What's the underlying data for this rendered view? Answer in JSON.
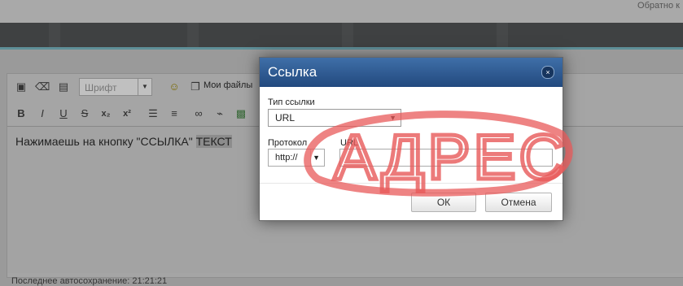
{
  "topbar": {
    "right_link": "Обратно к"
  },
  "toolbar": {
    "font_placeholder": "Шрифт",
    "my_files_label": "Мои файлы",
    "bold": "B",
    "italic": "I",
    "underline": "U",
    "strike": "S",
    "subscript": "x₂",
    "superscript": "x²"
  },
  "editor": {
    "text_before": "Нажимаешь на кнопку \"ССЫЛКА\" ",
    "text_selected": "ТЕКСТ",
    "autosave": "Последнее автосохранение: 21:21:21"
  },
  "dialog": {
    "title": "Ссылка",
    "link_type_label": "Тип ссылки",
    "link_type_value": "URL",
    "protocol_label": "Протокол",
    "protocol_value": "http://",
    "url_label": "URL",
    "url_value": "",
    "ok_label": "ОК",
    "cancel_label": "Отмена"
  },
  "annotation": {
    "text": "АДРЕС",
    "color": "#e85a5a"
  },
  "colors": {
    "dialog_header": "#2f5d95",
    "nav": "#3f4142",
    "overlay": "#9a9a9a"
  }
}
